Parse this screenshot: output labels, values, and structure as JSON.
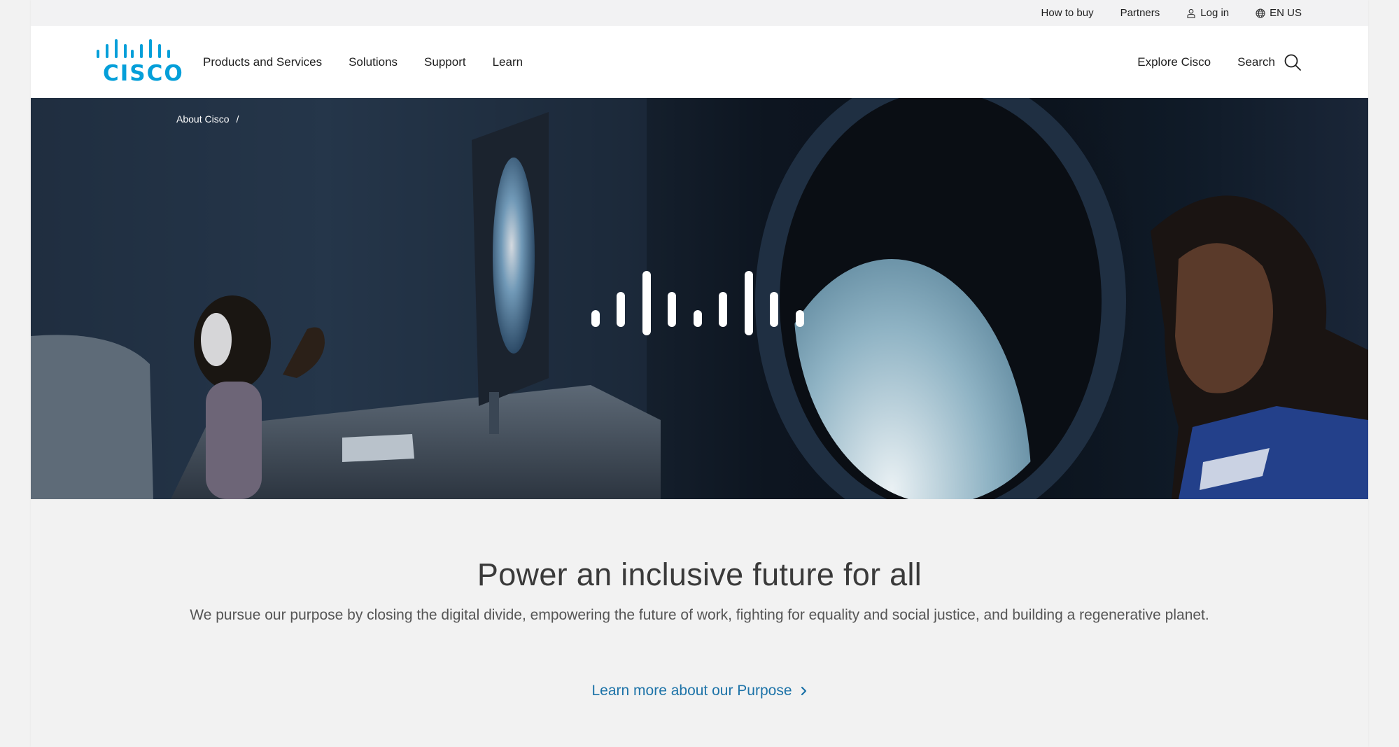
{
  "colors": {
    "brand_blue": "#049fd9",
    "link_blue": "#1d73a8",
    "header_bg": "#ffffff",
    "page_bg": "#f2f2f2"
  },
  "utility": {
    "how_to_buy": "How to buy",
    "partners": "Partners",
    "login": "Log in",
    "language": "EN US",
    "login_icon": "user-icon",
    "language_icon": "globe-icon"
  },
  "header": {
    "logo_text": "CISCO",
    "nav": [
      {
        "label": "Products and Services"
      },
      {
        "label": "Solutions"
      },
      {
        "label": "Support"
      },
      {
        "label": "Learn"
      }
    ],
    "explore": "Explore Cisco",
    "search": "Search",
    "search_icon": "search-icon"
  },
  "hero": {
    "breadcrumb": [
      "About Cisco",
      "/"
    ],
    "center_logo": "cisco-bridge-logo"
  },
  "content": {
    "headline": "Power an inclusive future for all",
    "subtext": "We pursue our purpose by closing the digital divide, empowering the future of work, fighting for equality and social justice, and building a regenerative planet.",
    "cta": "Learn more about our Purpose",
    "cta_icon": "chevron-right-icon"
  }
}
